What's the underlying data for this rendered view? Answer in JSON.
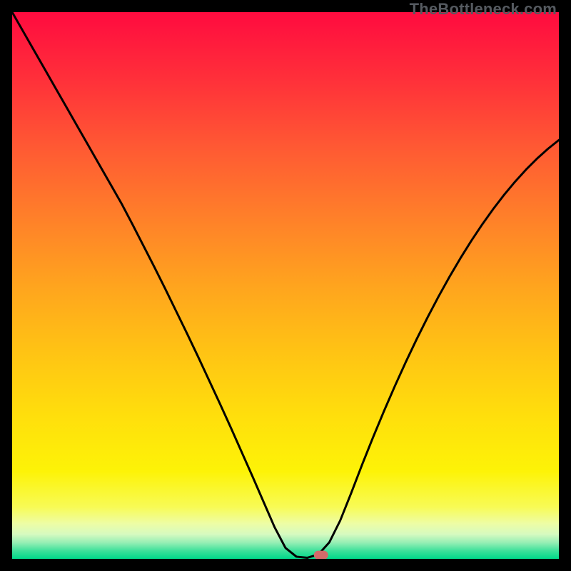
{
  "watermark": "TheBottleneck.com",
  "chart_data": {
    "type": "line",
    "title": "",
    "xlabel": "",
    "ylabel": "",
    "xlim": [
      0,
      100
    ],
    "ylim": [
      0,
      100
    ],
    "x": [
      0,
      2,
      4,
      6,
      8,
      10,
      12,
      14,
      16,
      18,
      20,
      22,
      24,
      26,
      28,
      30,
      32,
      34,
      36,
      38,
      40,
      42,
      44,
      46,
      48,
      50,
      52,
      54,
      56,
      58,
      60,
      62,
      64,
      66,
      68,
      70,
      72,
      74,
      76,
      78,
      80,
      82,
      84,
      86,
      88,
      90,
      92,
      94,
      96,
      98,
      100
    ],
    "values": [
      100,
      96.5,
      93,
      89.5,
      86,
      82.5,
      79,
      75.5,
      72,
      68.5,
      65,
      61.2,
      57.3,
      53.4,
      49.4,
      45.3,
      41.2,
      37,
      32.7,
      28.4,
      24,
      19.5,
      15,
      10.4,
      5.8,
      2,
      0.4,
      0.2,
      0.8,
      3,
      7,
      12,
      17.2,
      22.2,
      27,
      31.6,
      36,
      40.2,
      44.2,
      48,
      51.6,
      55,
      58.2,
      61.2,
      64,
      66.6,
      69,
      71.2,
      73.2,
      75,
      76.6
    ],
    "gradient_stops": [
      {
        "offset": 0.0,
        "color": "#ff0b3f"
      },
      {
        "offset": 0.12,
        "color": "#ff2f3a"
      },
      {
        "offset": 0.25,
        "color": "#ff5a33"
      },
      {
        "offset": 0.38,
        "color": "#ff8129"
      },
      {
        "offset": 0.5,
        "color": "#ffa41e"
      },
      {
        "offset": 0.62,
        "color": "#ffc314"
      },
      {
        "offset": 0.74,
        "color": "#ffdf0c"
      },
      {
        "offset": 0.84,
        "color": "#fdf307"
      },
      {
        "offset": 0.905,
        "color": "#f8fb55"
      },
      {
        "offset": 0.935,
        "color": "#eefda4"
      },
      {
        "offset": 0.955,
        "color": "#d6fac0"
      },
      {
        "offset": 0.97,
        "color": "#97efb5"
      },
      {
        "offset": 0.985,
        "color": "#3fe19b"
      },
      {
        "offset": 1.0,
        "color": "#00d98a"
      }
    ],
    "marker": {
      "x_frac": 0.565,
      "y_frac": 0.993,
      "color": "#d46a6a"
    }
  }
}
